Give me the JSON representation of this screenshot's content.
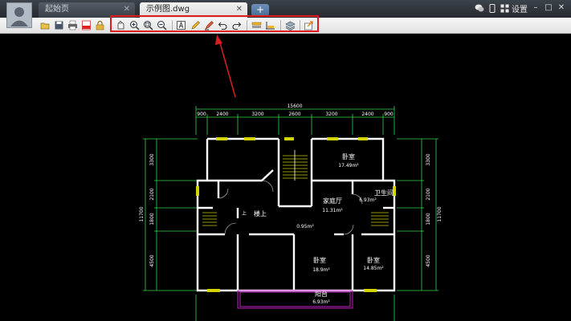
{
  "tabs": [
    {
      "label": "起始页",
      "close": "✕"
    },
    {
      "label": "示例图.dwg",
      "close": "✕"
    }
  ],
  "newtab": "+",
  "topright": {
    "settings": "设置",
    "minimize": "–",
    "maximize": "□",
    "close": "✕"
  },
  "toolbar": {
    "icons": [
      "open-icon",
      "save-icon",
      "print-icon",
      "pdf-icon",
      "lock-icon",
      "pan-icon",
      "zoom-in-icon",
      "zoom-window-icon",
      "zoom-extents-icon",
      "text-icon",
      "pencil-icon",
      "highlighter-icon",
      "undo-icon",
      "redo-icon",
      "layer-bar-icon",
      "measure-icon",
      "layers-icon",
      "export-icon"
    ],
    "highlight_color": "#e01b1b"
  },
  "drawing": {
    "top_total": "15600",
    "top_dims": [
      "900",
      "2400",
      "3200",
      "2600",
      "3200",
      "2400",
      "900"
    ],
    "left_dims": [
      "3300",
      "2100",
      "1800",
      "4500"
    ],
    "left_total": "11700",
    "right_dims": [
      "3300",
      "2100",
      "1800",
      "4500"
    ],
    "right_total": "11700",
    "rooms": [
      {
        "name": "卧室",
        "area": "17.49m²"
      },
      {
        "name": "卫生间",
        "area": "6.93m²"
      },
      {
        "name": "楼上",
        "area": ""
      },
      {
        "name": "家庭厅",
        "area": "11.31m²"
      },
      {
        "name": "卧室",
        "area": "18.9m²"
      },
      {
        "name": "卧室",
        "area": "14.85m²"
      },
      {
        "name": "阳台",
        "area": "6.93m²"
      }
    ],
    "misc": [
      "0.95m²",
      "上"
    ]
  }
}
